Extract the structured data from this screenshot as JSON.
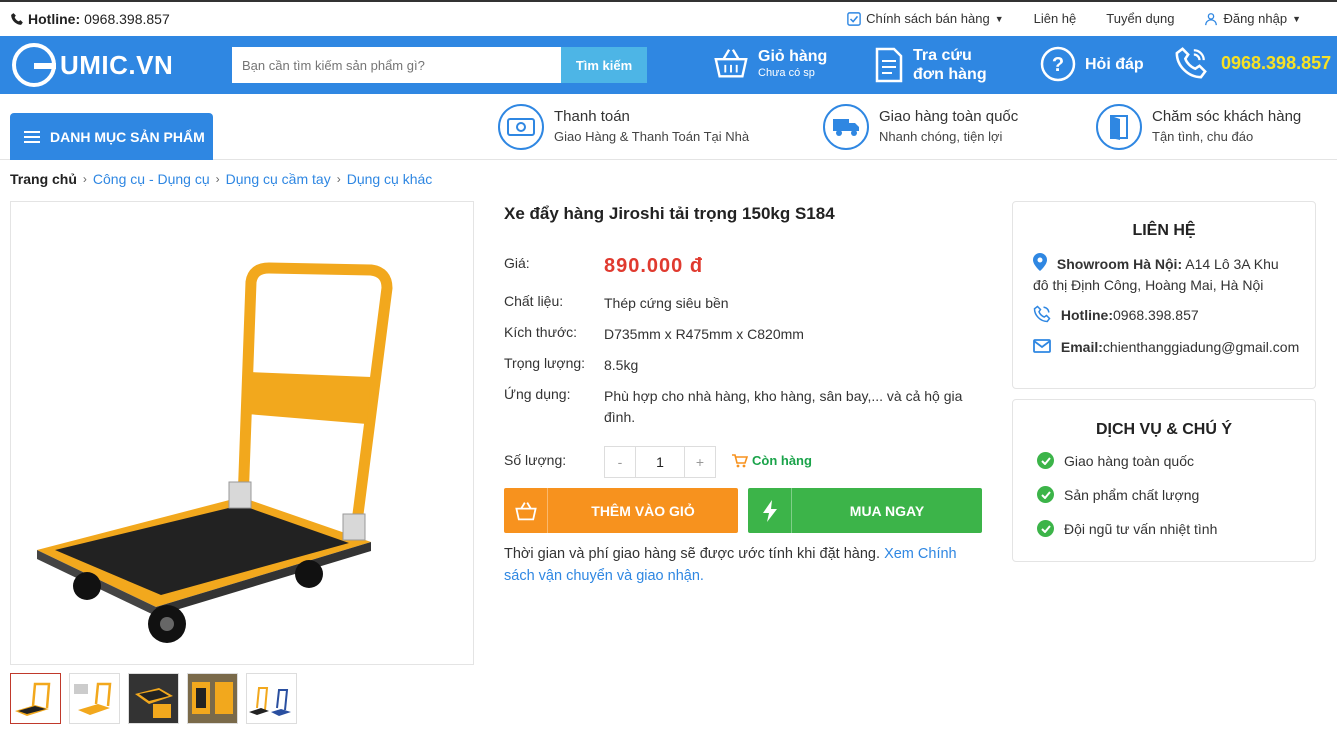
{
  "topbar": {
    "hotline_label": "Hotline:",
    "hotline_number": "0968.398.857",
    "policy": "Chính sách bán hàng",
    "contact": "Liên hệ",
    "recruit": "Tuyển dụng",
    "login": "Đăng nhập"
  },
  "header": {
    "logo": "UMIC.VN",
    "search_placeholder": "Bạn cần tìm kiếm sản phẩm gì?",
    "search_button": "Tìm kiếm",
    "cart_title": "Giỏ hàng",
    "cart_sub": "Chưa có sp",
    "order_line1": "Tra cứu",
    "order_line2": "đơn hàng",
    "faq": "Hỏi đáp",
    "phone": "0968.398.857"
  },
  "nav": {
    "category": "DANH MỤC SẢN PHẨM",
    "features": [
      {
        "title": "Thanh toán",
        "sub": "Giao Hàng & Thanh Toán Tại Nhà"
      },
      {
        "title": "Giao hàng toàn quốc",
        "sub": "Nhanh chóng, tiện lợi"
      },
      {
        "title": "Chăm sóc khách hàng",
        "sub": "Tận tình, chu đáo"
      }
    ]
  },
  "breadcrumb": [
    "Trang chủ",
    "Công cụ - Dụng cụ",
    "Dụng cụ cầm tay",
    "Dụng cụ khác"
  ],
  "product": {
    "title": "Xe đẩy hàng Jiroshi tải trọng 150kg S184",
    "price_label": "Giá:",
    "price": "890.000 đ",
    "specs": [
      {
        "label": "Chất liệu:",
        "value": "Thép cứng siêu bền"
      },
      {
        "label": "Kích thước:",
        "value": "D735mm x R475mm x C820mm"
      },
      {
        "label": "Trọng lượng:",
        "value": "8.5kg"
      },
      {
        "label": "Ứng dụng:",
        "value": "Phù hợp cho nhà hàng, kho hàng, sân bay,... và cả hộ gia đình."
      }
    ],
    "qty_label": "Số lượng:",
    "qty_minus": "-",
    "qty_value": "1",
    "qty_plus": "+",
    "stock": "Còn hàng",
    "add_cart": "THÊM VÀO GIỎ",
    "buy_now": "MUA NGAY",
    "ship_note": "Thời gian và phí giao hàng sẽ được ước tính khi đặt hàng.",
    "ship_link": "Xem Chính sách vận chuyển và giao nhận."
  },
  "contact_box": {
    "title": "LIÊN HỆ",
    "showroom_label": "Showroom Hà Nội:",
    "showroom_addr1": "A14 Lô 3A Khu",
    "showroom_addr2": "đô thị Định Công, Hoàng Mai, Hà Nội",
    "hotline_label": "Hotline:",
    "hotline": "0968.398.857",
    "email_label": "Email:",
    "email": "chienthanggiadung@gmail.com"
  },
  "service_box": {
    "title": "DỊCH VỤ & CHÚ Ý",
    "items": [
      "Giao hàng toàn quốc",
      "Sản phẩm chất lượng",
      "Đội ngũ tư vấn nhiệt tình"
    ]
  },
  "colors": {
    "primary": "#2f87e2",
    "price": "#e03a2f",
    "add_cart": "#f7921e",
    "buy_now": "#3cb449",
    "phone_highlight": "#f7e125"
  }
}
